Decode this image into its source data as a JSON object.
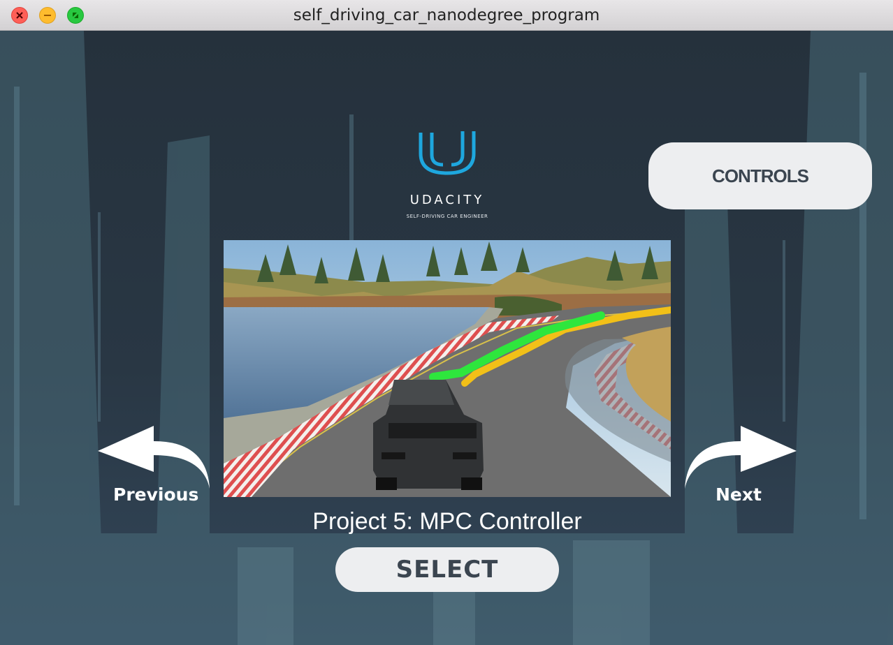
{
  "window": {
    "title": "self_driving_car_nanodegree_program"
  },
  "logo": {
    "wordmark": "UDACITY",
    "tagline": "SELF-DRIVING CAR ENGINEER",
    "color": "#1ea7de"
  },
  "menu": {
    "controls_label": "CONTROLS",
    "previous_label": "Previous",
    "next_label": "Next",
    "project_title": "Project 5: MPC Controller",
    "select_label": "SELECT"
  },
  "preview": {
    "image": "car-on-track-preview"
  },
  "colors": {
    "background": "#26323d",
    "button_bg": "#edeef0",
    "button_text": "#3b4550",
    "path_green": "#2ee63d",
    "path_yellow": "#f2c018"
  }
}
